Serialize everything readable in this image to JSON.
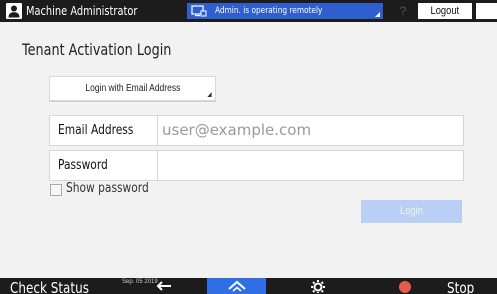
{
  "header": {
    "user_name": "Machine Administrator",
    "remote_status": "Admin. is operating remotely",
    "help_label": "?",
    "logout_label": "Logout"
  },
  "page": {
    "title": "Tenant Activation Login",
    "method_button_label": "Login with Email Address"
  },
  "form": {
    "email_label": "Email Address",
    "email_placeholder": "user@example.com",
    "email_value": "",
    "password_label": "Password",
    "password_value": "",
    "show_password_label": "Show password",
    "show_password_checked": false,
    "login_label": "Login"
  },
  "footer": {
    "check_status_label": "Check Status",
    "date": "Sep. 05 2019",
    "stop_label": "Stop"
  },
  "colors": {
    "top_bar": "#1c1c1c",
    "accent": "#2f6fe3",
    "login_disabled": "#b9cff3",
    "stop": "#e85a4f"
  },
  "icons": [
    "user-icon",
    "remote-monitor-icon",
    "moon-icon",
    "back-icon",
    "home-icon",
    "settings-icon",
    "stop-icon"
  ]
}
